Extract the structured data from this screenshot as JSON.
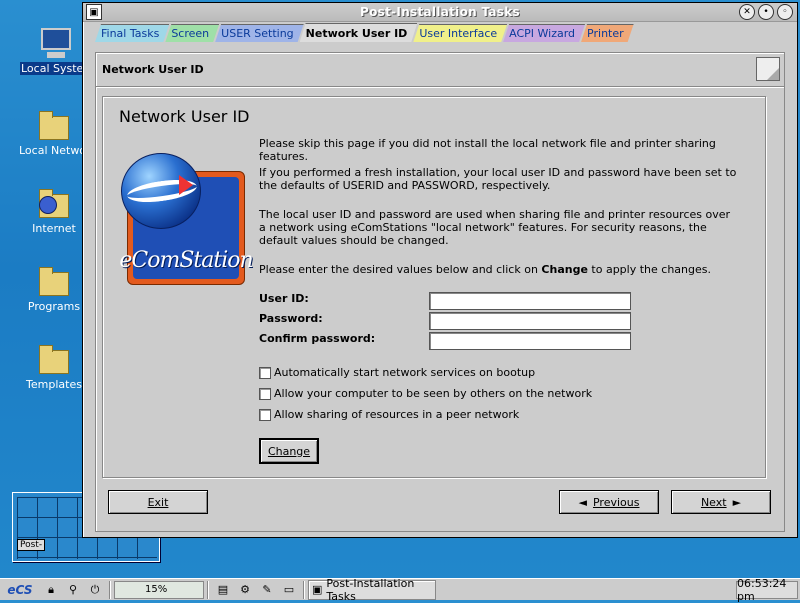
{
  "desktop": {
    "icons": [
      {
        "label": "Local System"
      },
      {
        "label": "Local Network"
      },
      {
        "label": "Internet"
      },
      {
        "label": "Programs"
      },
      {
        "label": "Templates"
      }
    ],
    "minimap_label": "Post-"
  },
  "window": {
    "title": "Post-Installation Tasks",
    "tabs": [
      {
        "label": "Final Tasks",
        "color": "#9fd8e8"
      },
      {
        "label": "Screen",
        "color": "#9fe0a8"
      },
      {
        "label": "USER Setting",
        "color": "#9fb4e8"
      },
      {
        "label": "Network User ID",
        "color": "#dddddd"
      },
      {
        "label": "User Interface",
        "color": "#f0f08a"
      },
      {
        "label": "ACPI Wizard",
        "color": "#c8a8e0"
      },
      {
        "label": "Printer",
        "color": "#f0a878"
      }
    ],
    "page_header": "Network User ID",
    "panel": {
      "title": "Network User ID",
      "logo_text": "eComStation",
      "para1": "Please skip this page if you did not install the local network file and printer sharing features.",
      "para2": "If you performed a fresh installation, your local user ID and password have been set to the defaults of USERID and PASSWORD, respectively.",
      "para3": "The local user ID and password are used when sharing file and printer resources over a network using eComStations \"local network\" features.  For security reasons, the default values should be changed.",
      "para4_pre": "Please enter the desired values below and click on ",
      "para4_bold": "Change",
      "para4_post": " to apply the changes.",
      "fields": {
        "user_id_label": "User ID:",
        "user_id_value": "",
        "password_label": "Password:",
        "password_value": "",
        "confirm_label": "Confirm password:",
        "confirm_value": ""
      },
      "checkboxes": [
        {
          "label": "Automatically start network services on bootup",
          "checked": false
        },
        {
          "label": "Allow your computer to be seen by others on the network",
          "checked": false
        },
        {
          "label": "Allow sharing of resources in a peer network",
          "checked": false
        }
      ],
      "change_label": "Change"
    },
    "buttons": {
      "exit": "Exit",
      "previous": "Previous",
      "next": "Next"
    }
  },
  "taskbar": {
    "cpu_label": "15%",
    "task_label": "Post-Installation Tasks",
    "clock": "06:53:24 pm"
  }
}
